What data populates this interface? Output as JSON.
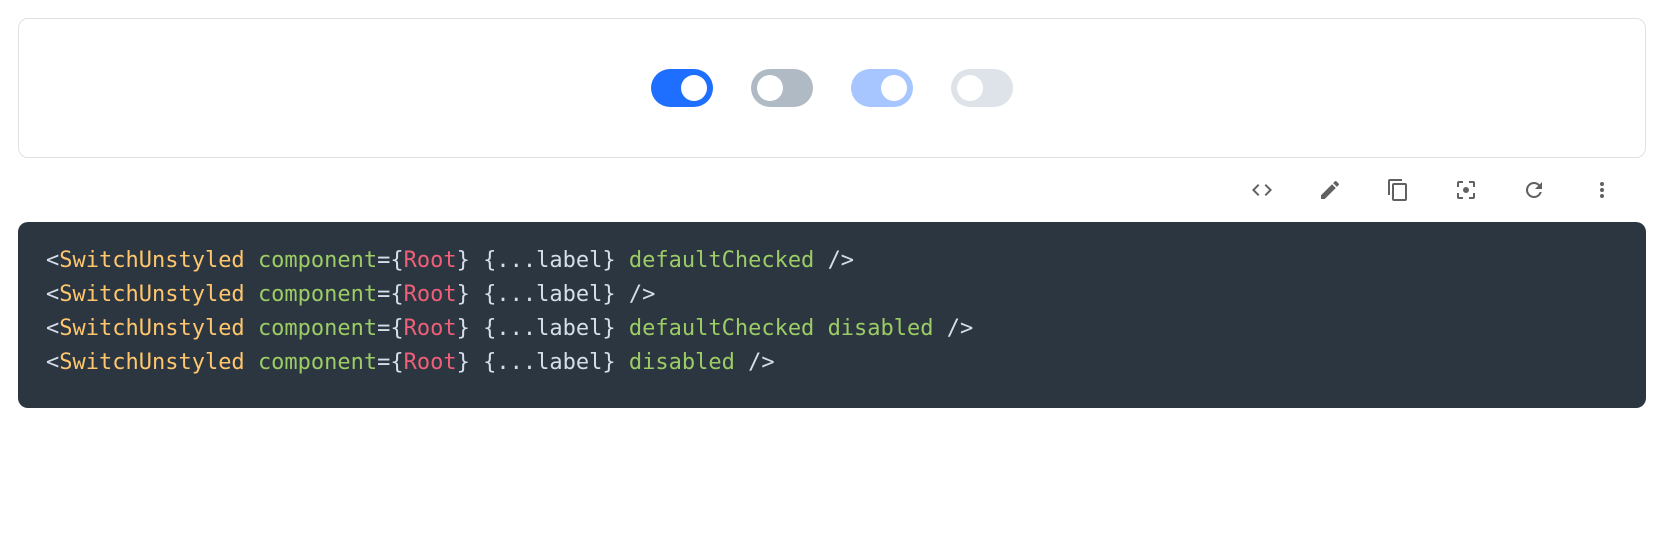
{
  "demo": {
    "switches": [
      {
        "state": "on",
        "interactable": true
      },
      {
        "state": "off",
        "interactable": true
      },
      {
        "state": "on-disabled",
        "interactable": false
      },
      {
        "state": "off-disabled",
        "interactable": false
      }
    ]
  },
  "toolbar": {
    "icons": [
      "code-icon",
      "edit-icon",
      "copy-icon",
      "fullscreen-icon",
      "refresh-icon",
      "more-icon"
    ]
  },
  "code": {
    "lines": [
      {
        "tokens": [
          {
            "t": "<",
            "c": "punc"
          },
          {
            "t": "SwitchUnstyled",
            "c": "tag"
          },
          {
            "t": " ",
            "c": "punc"
          },
          {
            "t": "component",
            "c": "attr"
          },
          {
            "t": "=",
            "c": "punc"
          },
          {
            "t": "{",
            "c": "punc"
          },
          {
            "t": "Root",
            "c": "val"
          },
          {
            "t": "}",
            "c": "punc"
          },
          {
            "t": " ",
            "c": "punc"
          },
          {
            "t": "{",
            "c": "punc"
          },
          {
            "t": "...",
            "c": "punc"
          },
          {
            "t": "label",
            "c": "attr2"
          },
          {
            "t": "}",
            "c": "punc"
          },
          {
            "t": " ",
            "c": "punc"
          },
          {
            "t": "defaultChecked",
            "c": "attr"
          },
          {
            "t": " ",
            "c": "punc"
          },
          {
            "t": "/>",
            "c": "punc"
          }
        ]
      },
      {
        "tokens": [
          {
            "t": "<",
            "c": "punc"
          },
          {
            "t": "SwitchUnstyled",
            "c": "tag"
          },
          {
            "t": " ",
            "c": "punc"
          },
          {
            "t": "component",
            "c": "attr"
          },
          {
            "t": "=",
            "c": "punc"
          },
          {
            "t": "{",
            "c": "punc"
          },
          {
            "t": "Root",
            "c": "val"
          },
          {
            "t": "}",
            "c": "punc"
          },
          {
            "t": " ",
            "c": "punc"
          },
          {
            "t": "{",
            "c": "punc"
          },
          {
            "t": "...",
            "c": "punc"
          },
          {
            "t": "label",
            "c": "attr2"
          },
          {
            "t": "}",
            "c": "punc"
          },
          {
            "t": " ",
            "c": "punc"
          },
          {
            "t": "/>",
            "c": "punc"
          }
        ]
      },
      {
        "tokens": [
          {
            "t": "<",
            "c": "punc"
          },
          {
            "t": "SwitchUnstyled",
            "c": "tag"
          },
          {
            "t": " ",
            "c": "punc"
          },
          {
            "t": "component",
            "c": "attr"
          },
          {
            "t": "=",
            "c": "punc"
          },
          {
            "t": "{",
            "c": "punc"
          },
          {
            "t": "Root",
            "c": "val"
          },
          {
            "t": "}",
            "c": "punc"
          },
          {
            "t": " ",
            "c": "punc"
          },
          {
            "t": "{",
            "c": "punc"
          },
          {
            "t": "...",
            "c": "punc"
          },
          {
            "t": "label",
            "c": "attr2"
          },
          {
            "t": "}",
            "c": "punc"
          },
          {
            "t": " ",
            "c": "punc"
          },
          {
            "t": "defaultChecked",
            "c": "attr"
          },
          {
            "t": " ",
            "c": "punc"
          },
          {
            "t": "disabled",
            "c": "attr"
          },
          {
            "t": " ",
            "c": "punc"
          },
          {
            "t": "/>",
            "c": "punc"
          }
        ]
      },
      {
        "tokens": [
          {
            "t": "<",
            "c": "punc"
          },
          {
            "t": "SwitchUnstyled",
            "c": "tag"
          },
          {
            "t": " ",
            "c": "punc"
          },
          {
            "t": "component",
            "c": "attr"
          },
          {
            "t": "=",
            "c": "punc"
          },
          {
            "t": "{",
            "c": "punc"
          },
          {
            "t": "Root",
            "c": "val"
          },
          {
            "t": "}",
            "c": "punc"
          },
          {
            "t": " ",
            "c": "punc"
          },
          {
            "t": "{",
            "c": "punc"
          },
          {
            "t": "...",
            "c": "punc"
          },
          {
            "t": "label",
            "c": "attr2"
          },
          {
            "t": "}",
            "c": "punc"
          },
          {
            "t": " ",
            "c": "punc"
          },
          {
            "t": "disabled",
            "c": "attr"
          },
          {
            "t": " ",
            "c": "punc"
          },
          {
            "t": "/>",
            "c": "punc"
          }
        ]
      }
    ]
  }
}
